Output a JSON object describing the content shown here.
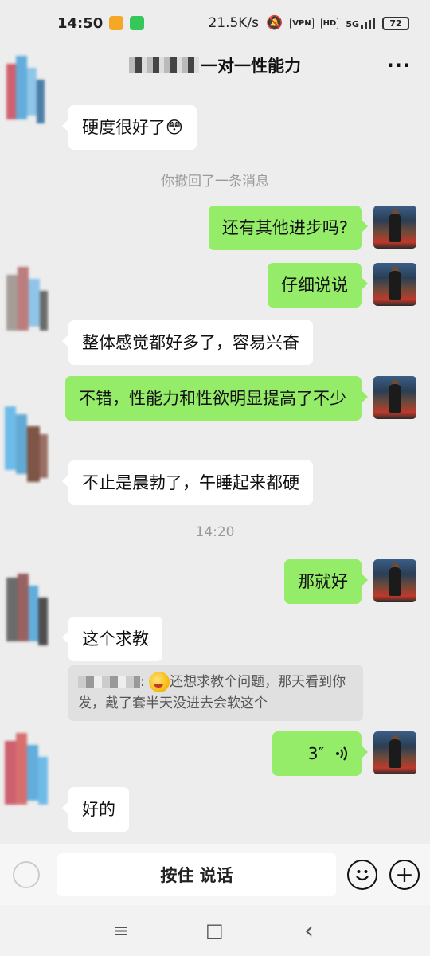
{
  "status_bar": {
    "time": "14:50",
    "network_speed": "21.5K/s",
    "vpn": "VPN",
    "hd": "HD",
    "signal": "5G",
    "battery": "72"
  },
  "header": {
    "title_suffix": "一对一性能力",
    "more": "···"
  },
  "messages": [
    {
      "side": "in",
      "text": "硬度很好了😳"
    },
    {
      "side": "system",
      "text": "你撤回了一条消息"
    },
    {
      "side": "out",
      "text": "还有其他进步吗?"
    },
    {
      "side": "out",
      "text": "仔细说说"
    },
    {
      "side": "in",
      "text": "整体感觉都好多了，容易兴奋"
    },
    {
      "side": "out",
      "text": "不错，性能力和性欲明显提高了不少"
    },
    {
      "side": "in",
      "text": "不止是晨勃了，午睡起来都硬"
    },
    {
      "side": "system",
      "text": "14:20"
    },
    {
      "side": "out",
      "text": "那就好"
    },
    {
      "side": "in",
      "text": "这个求教"
    },
    {
      "side": "out",
      "text": "3″"
    },
    {
      "side": "in",
      "text": "好的"
    }
  ],
  "quote": {
    "text": "还想求教个问题，那天看到你发，戴了套半天没进去会软这个"
  },
  "voice_icon": "voice-wave-icon",
  "input_bar": {
    "talk_label": "按住 说话",
    "emoji_icon": "emoji-icon",
    "add_label": "+"
  },
  "nav_bar": {
    "menu": "≡",
    "home": "□",
    "back": "‹"
  },
  "colors": {
    "background": "#ededed",
    "bubble_out": "#95ec69",
    "bubble_in": "#ffffff"
  }
}
